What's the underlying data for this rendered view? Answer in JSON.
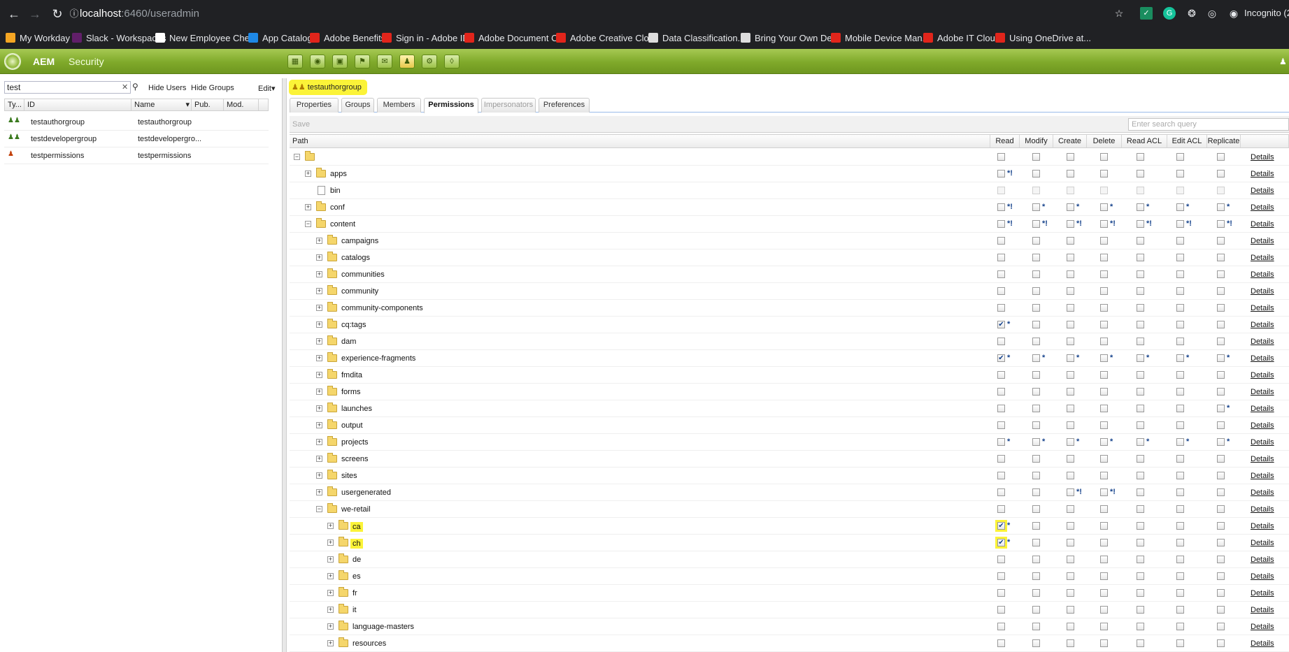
{
  "browser": {
    "url_host": "localhost",
    "url_path": ":6460/useradmin",
    "profile": "Incognito (2",
    "bookmarks": [
      {
        "label": "My Workday",
        "icon": "workday-icon",
        "color": "#f5a623"
      },
      {
        "label": "Slack - Workspaces",
        "icon": "slack-icon",
        "color": "#611f69"
      },
      {
        "label": "New Employee Che...",
        "icon": "document-icon",
        "color": "#ffffff"
      },
      {
        "label": "App Catalog",
        "icon": "app-catalog-icon",
        "color": "#1e88e5"
      },
      {
        "label": "Adobe Benefits",
        "icon": "adobe-icon",
        "color": "#e1251b"
      },
      {
        "label": "Sign in - Adobe ID",
        "icon": "adobe-icon",
        "color": "#e1251b"
      },
      {
        "label": "Adobe Document C...",
        "icon": "acrobat-icon",
        "color": "#e1251b"
      },
      {
        "label": "Adobe Creative Clo...",
        "icon": "adobe-icon",
        "color": "#e1251b"
      },
      {
        "label": "Data Classification...",
        "icon": "globe-icon",
        "color": "#dddddd"
      },
      {
        "label": "Bring Your Own De...",
        "icon": "settings-icon",
        "color": "#dddddd"
      },
      {
        "label": "Mobile Device Man...",
        "icon": "adobe-icon",
        "color": "#e1251b"
      },
      {
        "label": "Adobe IT Cloud",
        "icon": "cloud-icon",
        "color": "#e1251b"
      },
      {
        "label": "Using OneDrive at...",
        "icon": "adobe-icon",
        "color": "#e1251b"
      }
    ]
  },
  "aem": {
    "title": "AEM",
    "section": "Security",
    "accent": "#7fa92a"
  },
  "left": {
    "search_value": "test",
    "hide_users": "Hide Users",
    "hide_groups": "Hide Groups",
    "edit": "Edit",
    "columns": [
      "Ty...",
      "ID",
      "Name",
      "Pub.",
      "Mod."
    ],
    "rows": [
      {
        "type": "group",
        "id": "testauthorgroup",
        "name": "testauthorgroup"
      },
      {
        "type": "group",
        "id": "testdevelopergroup",
        "name": "testdevelopergro..."
      },
      {
        "type": "user",
        "id": "testpermissions",
        "name": "testpermissions"
      }
    ]
  },
  "right": {
    "selected_group": "testauthorgroup",
    "tabs": [
      {
        "label": "Properties",
        "state": "normal"
      },
      {
        "label": "Groups",
        "state": "normal"
      },
      {
        "label": "Members",
        "state": "normal"
      },
      {
        "label": "Permissions",
        "state": "active"
      },
      {
        "label": "Impersonators",
        "state": "disabled"
      },
      {
        "label": "Preferences",
        "state": "normal"
      }
    ],
    "save": "Save",
    "search_placeholder": "Enter search query",
    "columns": [
      "Path",
      "Read",
      "Modify",
      "Create",
      "Delete",
      "Read ACL",
      "Edit ACL",
      "Replicate",
      ""
    ],
    "details_label": "Details",
    "rows": [
      {
        "name": "",
        "level": 0,
        "expand": "-",
        "kind": "folder",
        "perms": [
          "",
          "",
          "",
          "",
          "",
          "",
          ""
        ]
      },
      {
        "name": "apps",
        "level": 1,
        "expand": "+",
        "kind": "folder",
        "perms": [
          "*!",
          "",
          "",
          "",
          "",
          "",
          ""
        ]
      },
      {
        "name": "bin",
        "level": 1,
        "expand": "",
        "kind": "file",
        "disabled": true,
        "perms": [
          "",
          "",
          "",
          "",
          "",
          "",
          ""
        ]
      },
      {
        "name": "conf",
        "level": 1,
        "expand": "+",
        "kind": "folder",
        "perms": [
          "*!",
          "*",
          "*",
          "*",
          "*",
          "*",
          "*"
        ]
      },
      {
        "name": "content",
        "level": 1,
        "expand": "-",
        "kind": "folder",
        "perms": [
          "*!",
          "*!",
          "*!",
          "*!",
          "*!",
          "*!",
          "*!"
        ]
      },
      {
        "name": "campaigns",
        "level": 2,
        "expand": "+",
        "kind": "folder",
        "perms": [
          "",
          "",
          "",
          "",
          "",
          "",
          ""
        ]
      },
      {
        "name": "catalogs",
        "level": 2,
        "expand": "+",
        "kind": "folder",
        "perms": [
          "",
          "",
          "",
          "",
          "",
          "",
          ""
        ]
      },
      {
        "name": "communities",
        "level": 2,
        "expand": "+",
        "kind": "folder",
        "perms": [
          "",
          "",
          "",
          "",
          "",
          "",
          ""
        ]
      },
      {
        "name": "community",
        "level": 2,
        "expand": "+",
        "kind": "folder",
        "perms": [
          "",
          "",
          "",
          "",
          "",
          "",
          ""
        ]
      },
      {
        "name": "community-components",
        "level": 2,
        "expand": "+",
        "kind": "folder",
        "perms": [
          "",
          "",
          "",
          "",
          "",
          "",
          ""
        ]
      },
      {
        "name": "cq:tags",
        "level": 2,
        "expand": "+",
        "kind": "folder",
        "perms": [
          "x*",
          "",
          "",
          "",
          "",
          "",
          ""
        ]
      },
      {
        "name": "dam",
        "level": 2,
        "expand": "+",
        "kind": "folder",
        "perms": [
          "",
          "",
          "",
          "",
          "",
          "",
          ""
        ]
      },
      {
        "name": "experience-fragments",
        "level": 2,
        "expand": "+",
        "kind": "folder",
        "perms": [
          "x*",
          "*",
          "*",
          "*",
          "*",
          "*",
          "*"
        ]
      },
      {
        "name": "fmdita",
        "level": 2,
        "expand": "+",
        "kind": "folder",
        "perms": [
          "",
          "",
          "",
          "",
          "",
          "",
          ""
        ]
      },
      {
        "name": "forms",
        "level": 2,
        "expand": "+",
        "kind": "folder",
        "perms": [
          "",
          "",
          "",
          "",
          "",
          "",
          ""
        ]
      },
      {
        "name": "launches",
        "level": 2,
        "expand": "+",
        "kind": "folder",
        "perms": [
          "",
          "",
          "",
          "",
          "",
          "",
          "*"
        ]
      },
      {
        "name": "output",
        "level": 2,
        "expand": "+",
        "kind": "folder",
        "perms": [
          "",
          "",
          "",
          "",
          "",
          "",
          ""
        ]
      },
      {
        "name": "projects",
        "level": 2,
        "expand": "+",
        "kind": "folder",
        "perms": [
          "*",
          "*",
          "*",
          "*",
          "*",
          "*",
          "*"
        ]
      },
      {
        "name": "screens",
        "level": 2,
        "expand": "+",
        "kind": "folder",
        "perms": [
          "",
          "",
          "",
          "",
          "",
          "",
          ""
        ]
      },
      {
        "name": "sites",
        "level": 2,
        "expand": "+",
        "kind": "folder",
        "perms": [
          "",
          "",
          "",
          "",
          "",
          "",
          ""
        ]
      },
      {
        "name": "usergenerated",
        "level": 2,
        "expand": "+",
        "kind": "folder",
        "perms": [
          "",
          "",
          "*!",
          "*!",
          "",
          "",
          ""
        ]
      },
      {
        "name": "we-retail",
        "level": 2,
        "expand": "-",
        "kind": "folder",
        "perms": [
          "",
          "",
          "",
          "",
          "",
          "",
          ""
        ]
      },
      {
        "name": "ca",
        "level": 3,
        "expand": "+",
        "kind": "folder",
        "highlight": true,
        "perms": [
          "x*",
          "",
          "",
          "",
          "",
          "",
          ""
        ]
      },
      {
        "name": "ch",
        "level": 3,
        "expand": "+",
        "kind": "folder",
        "highlight": true,
        "perms": [
          "x*",
          "",
          "",
          "",
          "",
          "",
          ""
        ]
      },
      {
        "name": "de",
        "level": 3,
        "expand": "+",
        "kind": "folder",
        "perms": [
          "",
          "",
          "",
          "",
          "",
          "",
          ""
        ]
      },
      {
        "name": "es",
        "level": 3,
        "expand": "+",
        "kind": "folder",
        "perms": [
          "",
          "",
          "",
          "",
          "",
          "",
          ""
        ]
      },
      {
        "name": "fr",
        "level": 3,
        "expand": "+",
        "kind": "folder",
        "perms": [
          "",
          "",
          "",
          "",
          "",
          "",
          ""
        ]
      },
      {
        "name": "it",
        "level": 3,
        "expand": "+",
        "kind": "folder",
        "perms": [
          "",
          "",
          "",
          "",
          "",
          "",
          ""
        ]
      },
      {
        "name": "language-masters",
        "level": 3,
        "expand": "+",
        "kind": "folder",
        "perms": [
          "",
          "",
          "",
          "",
          "",
          "",
          ""
        ]
      },
      {
        "name": "resources",
        "level": 3,
        "expand": "+",
        "kind": "folder",
        "perms": [
          "",
          "",
          "",
          "",
          "",
          "",
          ""
        ]
      }
    ]
  }
}
